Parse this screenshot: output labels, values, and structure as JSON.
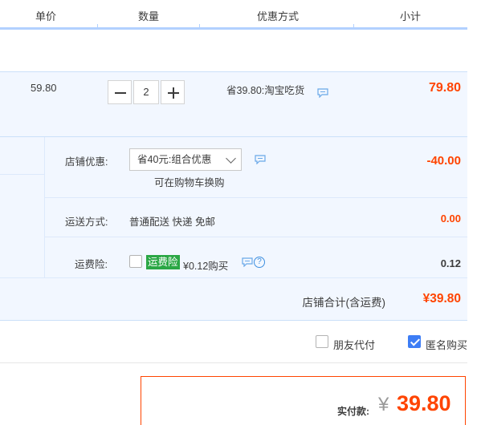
{
  "header": {
    "columns": [
      "单价",
      "数量",
      "优惠方式",
      "小计"
    ]
  },
  "item": {
    "price": "59.80",
    "quantity": "2",
    "promo": "省39.80:淘宝吃货",
    "subtotal": "79.80"
  },
  "shop": {
    "discount_label": "店铺优惠:",
    "discount_select": "省40元:组合优惠",
    "discount_hint": "可在购物车换购",
    "discount_amount": "-40.00",
    "shipping_label": "运送方式:",
    "shipping_value": "普通配送 快递 免邮",
    "shipping_amount": "0.00",
    "insurance_label": "运费险:",
    "insurance_tag": "运费险",
    "insurance_price": "¥0.12购买",
    "insurance_amount": "0.12",
    "total_label": "店铺合计(含运费)",
    "total_amount": "¥39.80"
  },
  "options": {
    "friend_pay": "朋友代付",
    "anonymous": "匿名购买",
    "anonymous_checked": true
  },
  "payment": {
    "label": "实付款:",
    "currency": "¥",
    "amount": "39.80"
  },
  "colors": {
    "accent_red": "#ff4400",
    "highlight_bg": "#f2f7ff",
    "header_line": "#b2d1ff",
    "green_tag": "#2ba745",
    "checkbox_blue": "#3d7df5"
  },
  "icons": [
    "chat-icon",
    "help-icon",
    "minus-icon",
    "plus-icon",
    "chevron-down-icon",
    "checkmark-icon"
  ]
}
